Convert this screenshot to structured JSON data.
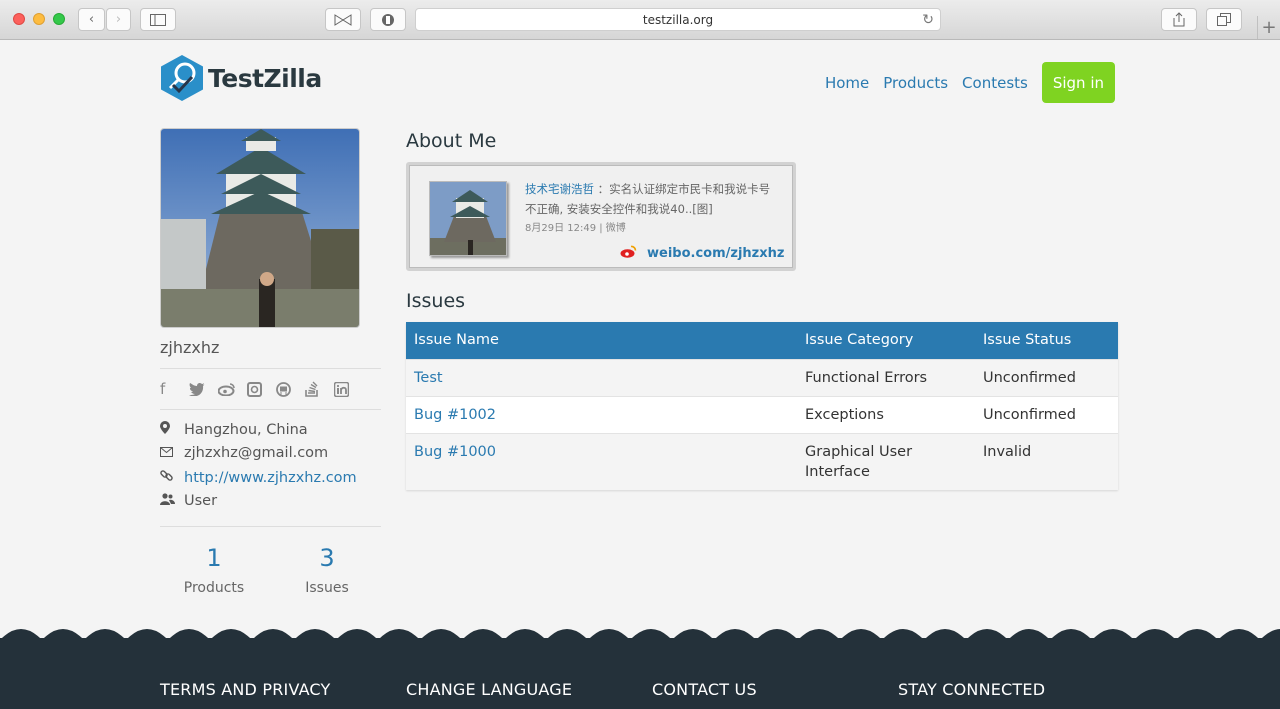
{
  "browser": {
    "url": "testzilla.org"
  },
  "header": {
    "logo_text": "TestZilla",
    "nav": [
      "Home",
      "Products",
      "Contests"
    ],
    "signin_label": "Sign in"
  },
  "profile": {
    "username": "zjhzxhz",
    "socials": [
      "facebook-icon",
      "twitter-icon",
      "weibo-icon",
      "instagram-icon",
      "github-icon",
      "stackoverflow-icon",
      "linkedin-icon"
    ],
    "location": "Hangzhou, China",
    "email": "zjhzxhz@gmail.com",
    "website": "http://www.zjhzxhz.com",
    "role": "User",
    "stats": {
      "products_count": "1",
      "products_label": "Products",
      "issues_count": "3",
      "issues_label": "Issues"
    }
  },
  "main": {
    "about_heading": "About Me",
    "weibo": {
      "author": "技术宅谢浩哲",
      "text": "：实名认证绑定市民卡和我说卡号不正确, 安装安全控件和我说40..[图]",
      "meta": "8月29日  12:49 | 微博",
      "link": "weibo.com/zjhzxhz"
    },
    "issues_heading": "Issues",
    "issues_table": {
      "columns": [
        "Issue Name",
        "Issue Category",
        "Issue Status"
      ],
      "rows": [
        {
          "name": "Test",
          "category": "Functional Errors",
          "status": "Unconfirmed"
        },
        {
          "name": "Bug #1002",
          "category": "Exceptions",
          "status": "Unconfirmed"
        },
        {
          "name": "Bug #1000",
          "category": "Graphical User Interface",
          "status": "Invalid"
        }
      ]
    }
  },
  "footer": {
    "columns": [
      "TERMS AND PRIVACY",
      "CHANGE LANGUAGE",
      "CONTACT US",
      "STAY CONNECTED"
    ]
  },
  "colors": {
    "accent": "#2a7ab0",
    "signin": "#7fd321",
    "footer": "#24313a"
  }
}
